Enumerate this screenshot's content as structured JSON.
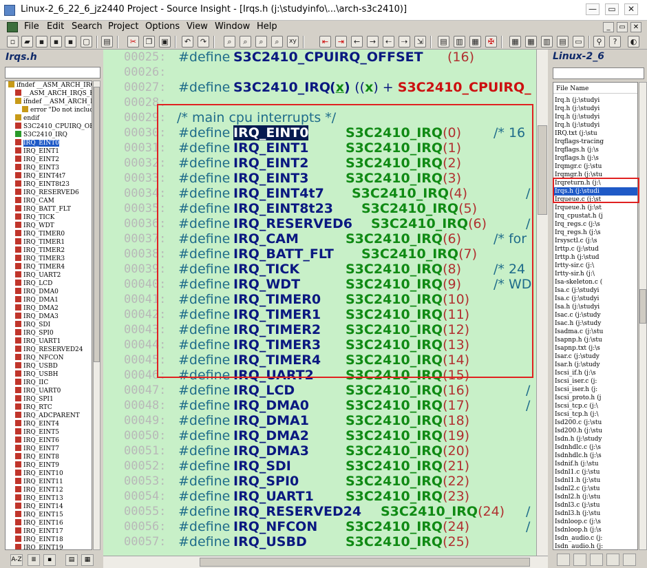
{
  "window": {
    "title": "Linux-2_6_22_6_jz2440 Project - Source Insight - [Irqs.h (j:\\studyinfo\\...\\arch-s3c2410)]",
    "minimize": "—",
    "restore": "▭",
    "close": "✕"
  },
  "menu": [
    "File",
    "Edit",
    "Search",
    "Project",
    "Options",
    "View",
    "Window",
    "Help"
  ],
  "mdi_buttons": {
    "minimize": "_",
    "restore": "▭",
    "close": "✕"
  },
  "left_panel": {
    "title": "Irqs.h",
    "symbols": [
      {
        "label": "ifndef __ASM_ARCH_IRQS_H",
        "icon": "g",
        "indent": 0
      },
      {
        "label": "__ASM_ARCH_IRQS_H",
        "icon": "r",
        "indent": 1
      },
      {
        "label": "ifndef __ASM_ARCH_IRQ",
        "icon": "g",
        "indent": 1
      },
      {
        "label": "error \"Do not include\"",
        "icon": "g",
        "indent": 2
      },
      {
        "label": "endif",
        "icon": "g",
        "indent": 1
      },
      {
        "label": "S3C2410_CPUIRQ_OFFSET",
        "icon": "r",
        "indent": 1
      },
      {
        "label": "S3C2410_IRQ",
        "icon": "gr",
        "indent": 1
      },
      {
        "label": "IRQ_EINT0",
        "icon": "r",
        "indent": 1,
        "selected": true
      },
      {
        "label": "IRQ_EINT1",
        "icon": "r",
        "indent": 1
      },
      {
        "label": "IRQ_EINT2",
        "icon": "r",
        "indent": 1
      },
      {
        "label": "IRQ_EINT3",
        "icon": "r",
        "indent": 1
      },
      {
        "label": "IRQ_EINT4t7",
        "icon": "r",
        "indent": 1
      },
      {
        "label": "IRQ_EINT8t23",
        "icon": "r",
        "indent": 1
      },
      {
        "label": "IRQ_RESERVED6",
        "icon": "r",
        "indent": 1
      },
      {
        "label": "IRQ_CAM",
        "icon": "r",
        "indent": 1
      },
      {
        "label": "IRQ_BATT_FLT",
        "icon": "r",
        "indent": 1
      },
      {
        "label": "IRQ_TICK",
        "icon": "r",
        "indent": 1
      },
      {
        "label": "IRQ_WDT",
        "icon": "r",
        "indent": 1
      },
      {
        "label": "IRQ_TIMER0",
        "icon": "r",
        "indent": 1
      },
      {
        "label": "IRQ_TIMER1",
        "icon": "r",
        "indent": 1
      },
      {
        "label": "IRQ_TIMER2",
        "icon": "r",
        "indent": 1
      },
      {
        "label": "IRQ_TIMER3",
        "icon": "r",
        "indent": 1
      },
      {
        "label": "IRQ_TIMER4",
        "icon": "r",
        "indent": 1
      },
      {
        "label": "IRQ_UART2",
        "icon": "r",
        "indent": 1
      },
      {
        "label": "IRQ_LCD",
        "icon": "r",
        "indent": 1
      },
      {
        "label": "IRQ_DMA0",
        "icon": "r",
        "indent": 1
      },
      {
        "label": "IRQ_DMA1",
        "icon": "r",
        "indent": 1
      },
      {
        "label": "IRQ_DMA2",
        "icon": "r",
        "indent": 1
      },
      {
        "label": "IRQ_DMA3",
        "icon": "r",
        "indent": 1
      },
      {
        "label": "IRQ_SDI",
        "icon": "r",
        "indent": 1
      },
      {
        "label": "IRQ_SPI0",
        "icon": "r",
        "indent": 1
      },
      {
        "label": "IRQ_UART1",
        "icon": "r",
        "indent": 1
      },
      {
        "label": "IRQ_RESERVED24",
        "icon": "r",
        "indent": 1
      },
      {
        "label": "IRQ_NFCON",
        "icon": "r",
        "indent": 1
      },
      {
        "label": "IRQ_USBD",
        "icon": "r",
        "indent": 1
      },
      {
        "label": "IRQ_USBH",
        "icon": "r",
        "indent": 1
      },
      {
        "label": "IRQ_IIC",
        "icon": "r",
        "indent": 1
      },
      {
        "label": "IRQ_UART0",
        "icon": "r",
        "indent": 1
      },
      {
        "label": "IRQ_SPI1",
        "icon": "r",
        "indent": 1
      },
      {
        "label": "IRQ_RTC",
        "icon": "r",
        "indent": 1
      },
      {
        "label": "IRQ_ADCPARENT",
        "icon": "r",
        "indent": 1
      },
      {
        "label": "IRQ_EINT4",
        "icon": "r",
        "indent": 1
      },
      {
        "label": "IRQ_EINT5",
        "icon": "r",
        "indent": 1
      },
      {
        "label": "IRQ_EINT6",
        "icon": "r",
        "indent": 1
      },
      {
        "label": "IRQ_EINT7",
        "icon": "r",
        "indent": 1
      },
      {
        "label": "IRQ_EINT8",
        "icon": "r",
        "indent": 1
      },
      {
        "label": "IRQ_EINT9",
        "icon": "r",
        "indent": 1
      },
      {
        "label": "IRQ_EINT10",
        "icon": "r",
        "indent": 1
      },
      {
        "label": "IRQ_EINT11",
        "icon": "r",
        "indent": 1
      },
      {
        "label": "IRQ_EINT12",
        "icon": "r",
        "indent": 1
      },
      {
        "label": "IRQ_EINT13",
        "icon": "r",
        "indent": 1
      },
      {
        "label": "IRQ_EINT14",
        "icon": "r",
        "indent": 1
      },
      {
        "label": "IRQ_EINT15",
        "icon": "r",
        "indent": 1
      },
      {
        "label": "IRQ_EINT16",
        "icon": "r",
        "indent": 1
      },
      {
        "label": "IRQ_EINT17",
        "icon": "r",
        "indent": 1
      },
      {
        "label": "IRQ_EINT18",
        "icon": "r",
        "indent": 1
      },
      {
        "label": "IRQ_EINT19",
        "icon": "r",
        "indent": 1
      }
    ],
    "bottom_buttons": [
      "A-Z",
      "≣",
      "▪",
      "▤",
      "▦"
    ]
  },
  "editor": {
    "lines": [
      {
        "num": "00025:",
        "kind": "define",
        "name": "S3C2410_CPUIRQ_OFFSET",
        "value": "",
        "arg": "(16)"
      },
      {
        "num": "00026:",
        "kind": "blank"
      },
      {
        "num": "00027:",
        "kind": "define_macro",
        "name": "S3C2410_IRQ",
        "param": "x",
        "body_open": "((",
        "body_x": "x",
        "body_plus": ") + ",
        "body_const": "S3C2410_CPUIRQ_"
      },
      {
        "num": "00028:",
        "kind": "blank"
      },
      {
        "num": "00029:",
        "kind": "comment",
        "text": "/* main cpu interrupts */"
      },
      {
        "num": "00030:",
        "kind": "define",
        "name": "IRQ_EINT0",
        "value": "S3C2410_IRQ",
        "arg": "(0)",
        "comment": "/* 16",
        "highlight": true
      },
      {
        "num": "00031:",
        "kind": "define",
        "name": "IRQ_EINT1",
        "value": "S3C2410_IRQ",
        "arg": "(1)"
      },
      {
        "num": "00032:",
        "kind": "define",
        "name": "IRQ_EINT2",
        "value": "S3C2410_IRQ",
        "arg": "(2)"
      },
      {
        "num": "00033:",
        "kind": "define",
        "name": "IRQ_EINT3",
        "value": "S3C2410_IRQ",
        "arg": "(3)"
      },
      {
        "num": "00034:",
        "kind": "define",
        "name": "IRQ_EINT4t7",
        "value": "S3C2410_IRQ",
        "arg": "(4)",
        "comment": "/"
      },
      {
        "num": "00035:",
        "kind": "define",
        "name": "IRQ_EINT8t23",
        "value": "S3C2410_IRQ",
        "arg": "(5)"
      },
      {
        "num": "00036:",
        "kind": "define",
        "name": "IRQ_RESERVED6",
        "value": "S3C2410_IRQ",
        "arg": "(6)",
        "comment": "/"
      },
      {
        "num": "00037:",
        "kind": "define",
        "name": "IRQ_CAM",
        "value": "S3C2410_IRQ",
        "arg": "(6)",
        "comment": "/* for"
      },
      {
        "num": "00038:",
        "kind": "define",
        "name": "IRQ_BATT_FLT",
        "value": "S3C2410_IRQ",
        "arg": "(7)"
      },
      {
        "num": "00039:",
        "kind": "define",
        "name": "IRQ_TICK",
        "value": "S3C2410_IRQ",
        "arg": "(8)",
        "comment": "/* 24"
      },
      {
        "num": "00040:",
        "kind": "define",
        "name": "IRQ_WDT",
        "value": "S3C2410_IRQ",
        "arg": "(9)",
        "comment": "/* WD"
      },
      {
        "num": "00041:",
        "kind": "define",
        "name": "IRQ_TIMER0",
        "value": "S3C2410_IRQ",
        "arg": "(10)"
      },
      {
        "num": "00042:",
        "kind": "define",
        "name": "IRQ_TIMER1",
        "value": "S3C2410_IRQ",
        "arg": "(11)"
      },
      {
        "num": "00043:",
        "kind": "define",
        "name": "IRQ_TIMER2",
        "value": "S3C2410_IRQ",
        "arg": "(12)"
      },
      {
        "num": "00044:",
        "kind": "define",
        "name": "IRQ_TIMER3",
        "value": "S3C2410_IRQ",
        "arg": "(13)"
      },
      {
        "num": "00045:",
        "kind": "define",
        "name": "IRQ_TIMER4",
        "value": "S3C2410_IRQ",
        "arg": "(14)"
      },
      {
        "num": "00046:",
        "kind": "define",
        "name": "IRQ_UART2",
        "value": "S3C2410_IRQ",
        "arg": "(15)"
      },
      {
        "num": "00047:",
        "kind": "define",
        "name": "IRQ_LCD",
        "value": "S3C2410_IRQ",
        "arg": "(16)",
        "comment": "/"
      },
      {
        "num": "00048:",
        "kind": "define",
        "name": "IRQ_DMA0",
        "value": "S3C2410_IRQ",
        "arg": "(17)",
        "comment": "/"
      },
      {
        "num": "00049:",
        "kind": "define",
        "name": "IRQ_DMA1",
        "value": "S3C2410_IRQ",
        "arg": "(18)"
      },
      {
        "num": "00050:",
        "kind": "define",
        "name": "IRQ_DMA2",
        "value": "S3C2410_IRQ",
        "arg": "(19)"
      },
      {
        "num": "00051:",
        "kind": "define",
        "name": "IRQ_DMA3",
        "value": "S3C2410_IRQ",
        "arg": "(20)"
      },
      {
        "num": "00052:",
        "kind": "define",
        "name": "IRQ_SDI",
        "value": "S3C2410_IRQ",
        "arg": "(21)"
      },
      {
        "num": "00053:",
        "kind": "define",
        "name": "IRQ_SPI0",
        "value": "S3C2410_IRQ",
        "arg": "(22)"
      },
      {
        "num": "00054:",
        "kind": "define",
        "name": "IRQ_UART1",
        "value": "S3C2410_IRQ",
        "arg": "(23)"
      },
      {
        "num": "00055:",
        "kind": "define",
        "name": "IRQ_RESERVED24",
        "value": "S3C2410_IRQ",
        "arg": "(24)",
        "comment": "/"
      },
      {
        "num": "00056:",
        "kind": "define",
        "name": "IRQ_NFCON",
        "value": "S3C2410_IRQ",
        "arg": "(24)",
        "comment": "/"
      },
      {
        "num": "00057:",
        "kind": "define",
        "name": "IRQ_USBD",
        "value": "S3C2410_IRQ",
        "arg": "(25)"
      }
    ],
    "keyword": "#define"
  },
  "right_panel": {
    "title": "Linux-2_6",
    "column_header": "File Name",
    "files": [
      {
        "label": "Irq.h (j:\\studyi"
      },
      {
        "label": "Irq.h (j:\\studyi"
      },
      {
        "label": "Irq.h (j:\\studyi"
      },
      {
        "label": "Irq.h (j:\\studyi"
      },
      {
        "label": "IRQ.txt (j:\\stu"
      },
      {
        "label": "Irqflags-tracing"
      },
      {
        "label": "Irqflags.h (j:\\s"
      },
      {
        "label": "Irqflags.h (j:\\s"
      },
      {
        "label": "Irqmgr.c (j:\\stu"
      },
      {
        "label": "Irqmgr.h (j:\\stu"
      },
      {
        "label": "Irqreturn.h (j:\\"
      },
      {
        "label": "Irqs.h (j:\\studi",
        "selected": true
      },
      {
        "label": "Irqueue.c (j:\\st"
      },
      {
        "label": "Irqueue.h (j:\\st"
      },
      {
        "label": "Irq_cpustat.h (j"
      },
      {
        "label": "Irq_regs.c (j:\\s"
      },
      {
        "label": "Irq_regs.h (j:\\s"
      },
      {
        "label": "Irsysctl.c (j:\\s"
      },
      {
        "label": "Irttp.c (j:\\stud"
      },
      {
        "label": "Irttp.h (j:\\stud"
      },
      {
        "label": "Irtty-sir.c (j:\\"
      },
      {
        "label": "Irtty-sir.h (j:\\"
      },
      {
        "label": "Isa-skeleton.c ("
      },
      {
        "label": "Isa.c (j:\\studyi"
      },
      {
        "label": "Isa.c (j:\\studyi"
      },
      {
        "label": "Isa.h (j:\\studyi"
      },
      {
        "label": "Isac.c (j:\\study"
      },
      {
        "label": "Isac.h (j:\\study"
      },
      {
        "label": "Isadma.c (j:\\stu"
      },
      {
        "label": "Isapnp.h (j:\\stu"
      },
      {
        "label": "Isapnp.txt (j:\\s"
      },
      {
        "label": "Isar.c (j:\\study"
      },
      {
        "label": "Isar.h (j:\\study"
      },
      {
        "label": "Iscsi_if.h (j:\\s"
      },
      {
        "label": "Iscsi_iser.c (j:"
      },
      {
        "label": "Iscsi_iser.h (j:"
      },
      {
        "label": "Iscsi_proto.h (j"
      },
      {
        "label": "Iscsi_tcp.c (j:\\"
      },
      {
        "label": "Iscsi_tcp.h (j:\\"
      },
      {
        "label": "Isd200.c (j:\\stu"
      },
      {
        "label": "Isd200.h (j:\\stu"
      },
      {
        "label": "Isdn.h (j:\\study"
      },
      {
        "label": "Isdnhdlc.c (j:\\s"
      },
      {
        "label": "Isdnhdlc.h (j:\\s"
      },
      {
        "label": "Isdnif.h (j:\\stu"
      },
      {
        "label": "Isdnl1.c (j:\\stu"
      },
      {
        "label": "Isdnl1.h (j:\\stu"
      },
      {
        "label": "Isdnl2.c (j:\\stu"
      },
      {
        "label": "Isdnl2.h (j:\\stu"
      },
      {
        "label": "Isdnl3.c (j:\\stu"
      },
      {
        "label": "Isdnl3.h (j:\\stu"
      },
      {
        "label": "Isdnloop.c (j:\\s"
      },
      {
        "label": "Isdnloop.h (j:\\s"
      },
      {
        "label": "Isdn_audio.c (j:"
      },
      {
        "label": "Isdn_audio.h (j:"
      }
    ]
  }
}
